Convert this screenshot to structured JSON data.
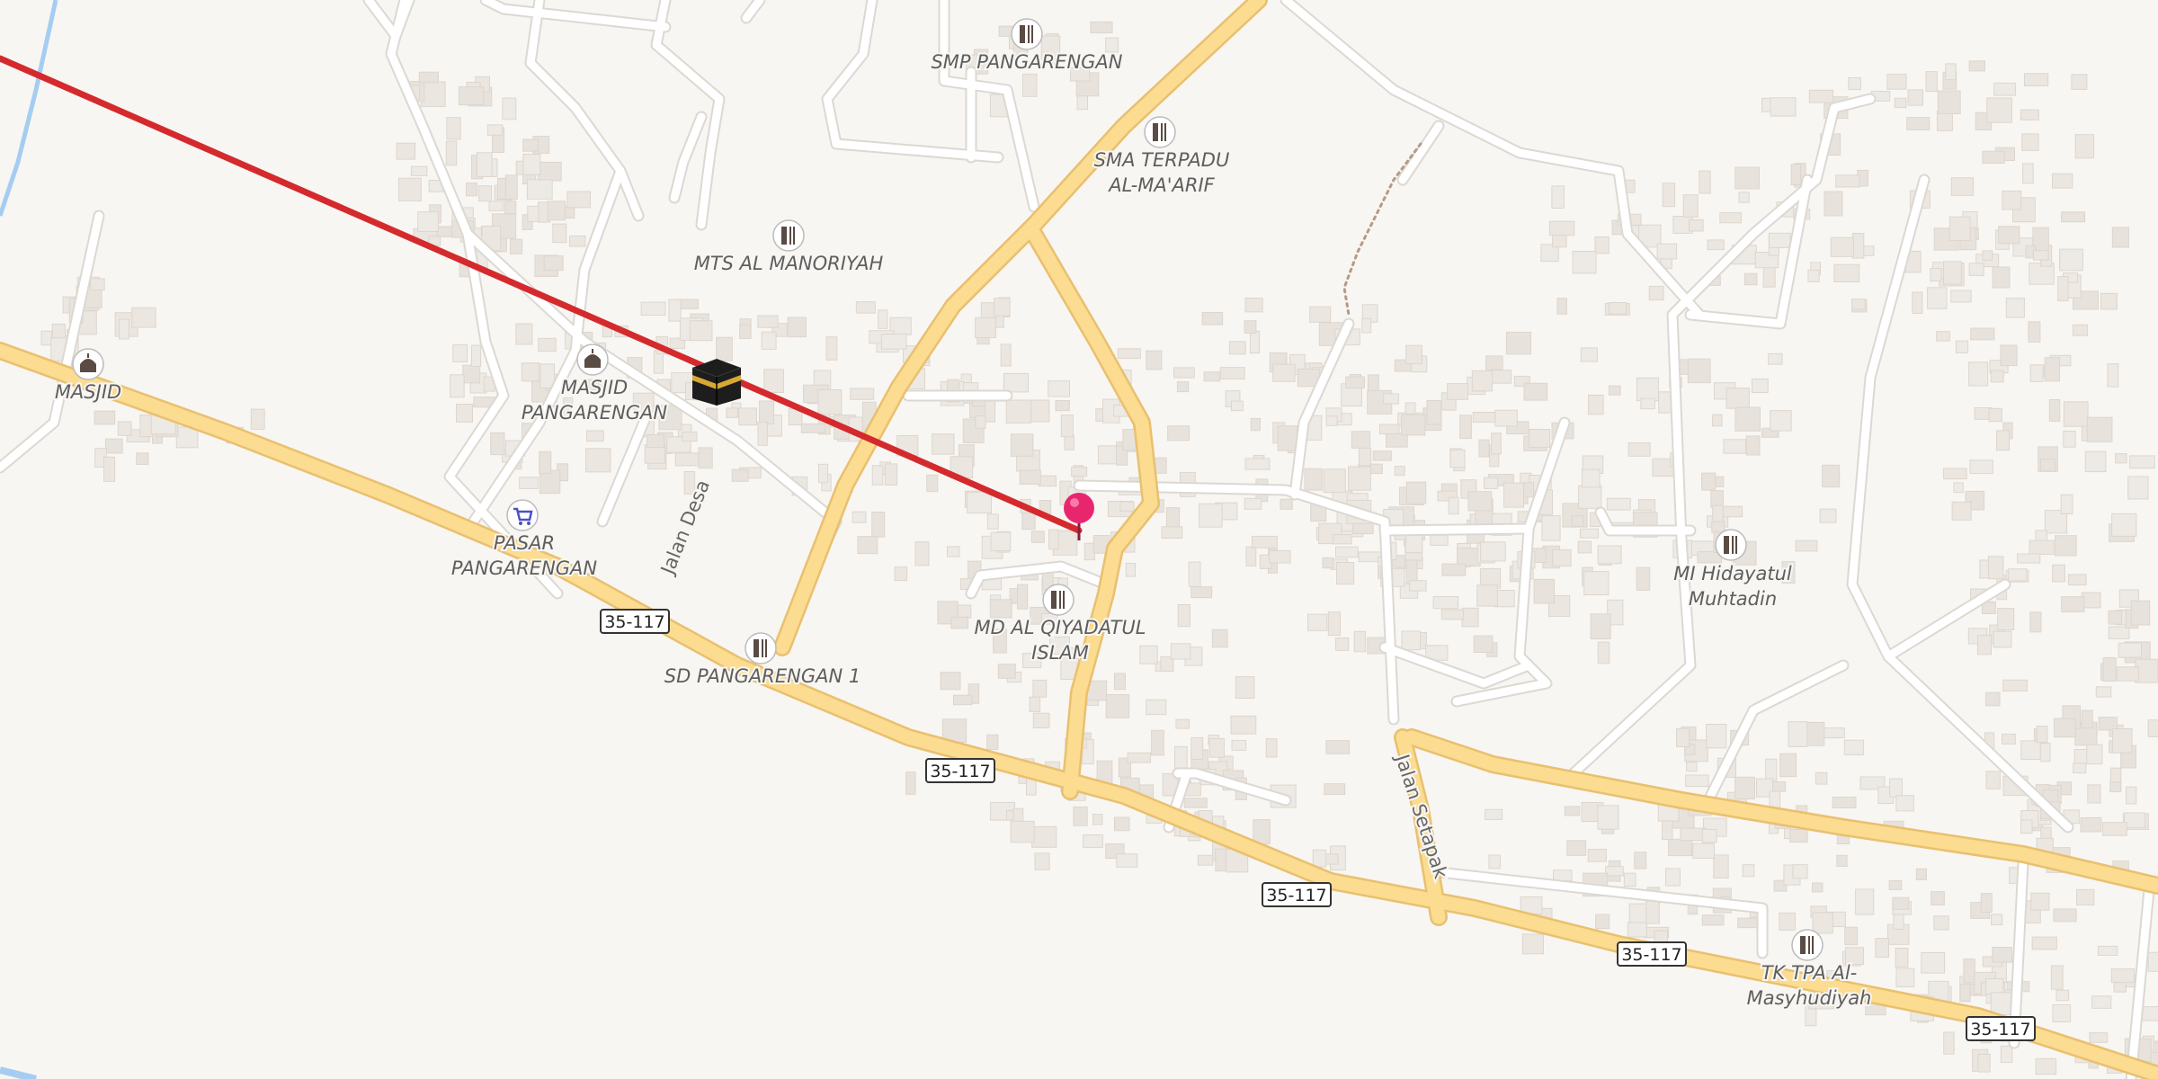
{
  "map": {
    "colors": {
      "background": "#f8f6f2",
      "major_road": "#fbdc90",
      "major_road_casing": "#e9c070",
      "minor_road": "#ffffff",
      "minor_road_casing": "#dcd8d2",
      "building": "#ebe6e0",
      "water": "#a5cdf2",
      "route_line": "#d42a2e",
      "pin": "#e8266e"
    },
    "route_shields": [
      "35-117",
      "35-117",
      "35-117",
      "35-117",
      "35-117"
    ],
    "streets": [
      "Jalan Desa",
      "Jalan Setapak"
    ],
    "pois": [
      {
        "label": "SMP PANGARENGAN",
        "icon": "school-icon"
      },
      {
        "label": "SMA TERPADU",
        "label2": "AL-MA'ARIF",
        "icon": "school-icon"
      },
      {
        "label": "MTS AL MANORIYAH",
        "icon": "school-icon"
      },
      {
        "label": "MASJID",
        "icon": "mosque-icon"
      },
      {
        "label": "MASJID",
        "label2": "PANGARENGAN",
        "icon": "mosque-icon"
      },
      {
        "label": "PASAR",
        "label2": "PANGARENGAN",
        "icon": "shopping-cart-icon"
      },
      {
        "label": "SD PANGARENGAN 1",
        "icon": "school-icon"
      },
      {
        "label": "MD AL QIYADATUL",
        "label2": "ISLAM",
        "icon": "school-icon"
      },
      {
        "label": "MI Hidayatul",
        "label2": "Muhtadin",
        "icon": "school-icon"
      },
      {
        "label": "TK TPA Al-",
        "label2": "Masyhudiyah",
        "icon": "school-icon"
      }
    ],
    "markers": {
      "kaaba": "kaaba-icon",
      "pin": "location-pin-icon"
    }
  }
}
